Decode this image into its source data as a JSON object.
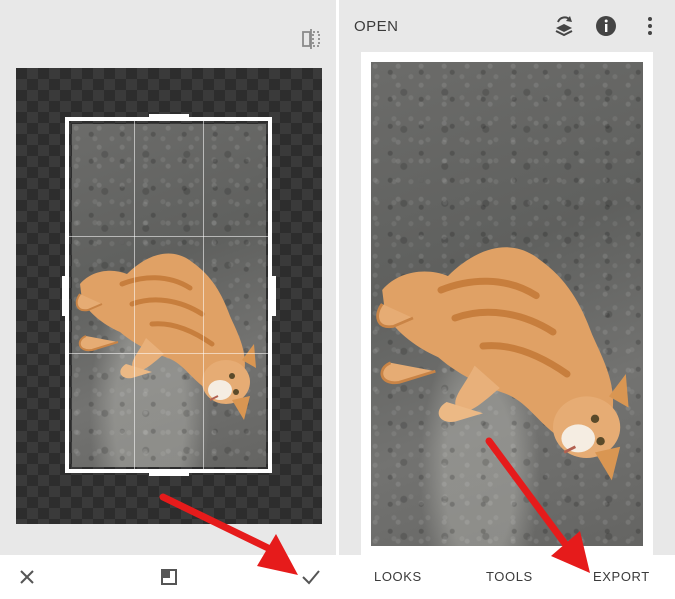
{
  "left_panel": {
    "toolbar": {
      "cancel_icon": "close-icon",
      "aspect_icon": "aspect-ratio-icon",
      "apply_icon": "checkmark-icon",
      "compare_icon": "compare-icon"
    },
    "canvas": {
      "background": "checkerboard"
    }
  },
  "right_panel": {
    "header": {
      "open_label": "OPEN",
      "icons": [
        "layers-icon",
        "info-icon",
        "more-vert-icon"
      ]
    },
    "bottom_nav": {
      "items": [
        {
          "label": "LOOKS"
        },
        {
          "label": "TOOLS"
        },
        {
          "label": "EXPORT"
        }
      ]
    }
  },
  "annotations": {
    "arrow_color": "#e61b1b"
  },
  "colors": {
    "panel_bg": "#e8e8e8",
    "text": "#3b3b3b",
    "canvas_dark": "#2d2d2d"
  }
}
